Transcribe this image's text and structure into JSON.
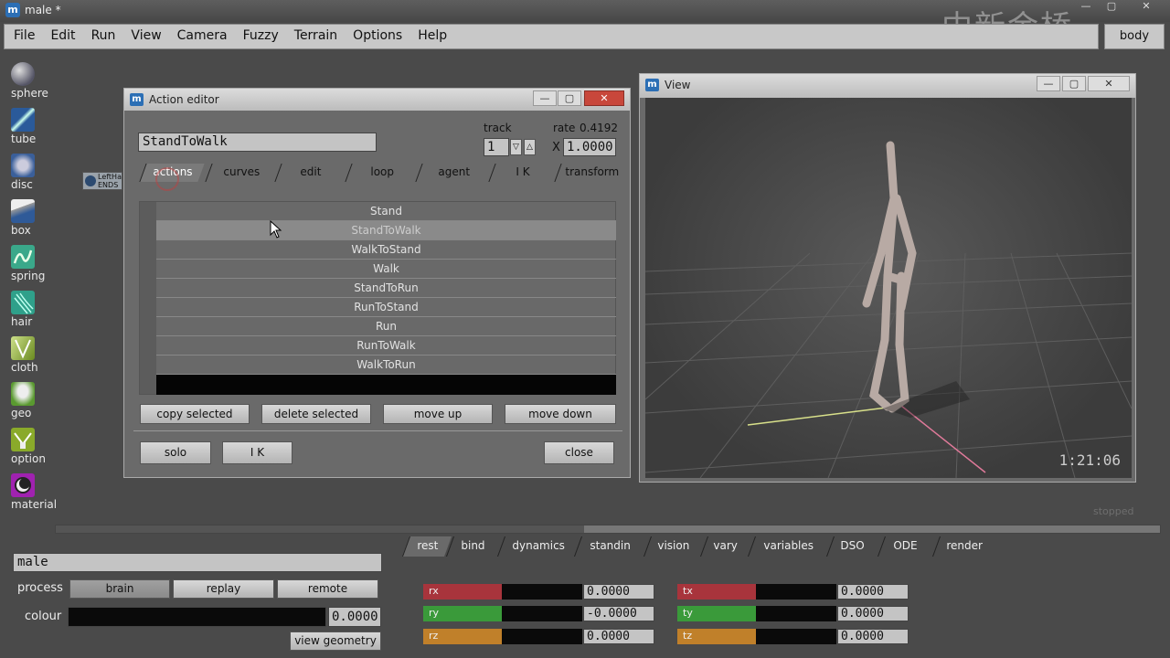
{
  "window": {
    "title": "male *",
    "watermark": "中新金桥",
    "min": "—",
    "max": "▢",
    "close": "✕"
  },
  "menu": {
    "items": [
      "File",
      "Edit",
      "Run",
      "View",
      "Camera",
      "Fuzzy",
      "Terrain",
      "Options",
      "Help"
    ],
    "body_button": "body"
  },
  "tools": [
    {
      "label": "sphere",
      "icon": "sphere-icon",
      "color": "#3a6aa8"
    },
    {
      "label": "tube",
      "icon": "tube-icon",
      "color": "#4a7ac0"
    },
    {
      "label": "disc",
      "icon": "disc-icon",
      "color": "#3f6fb0"
    },
    {
      "label": "box",
      "icon": "box-icon",
      "color": "#2f64a8"
    },
    {
      "label": "spring",
      "icon": "spring-icon",
      "color": "#3aa88a"
    },
    {
      "label": "hair",
      "icon": "hair-icon",
      "color": "#2fa08a"
    },
    {
      "label": "cloth",
      "icon": "cloth-icon",
      "color": "#7aa020"
    },
    {
      "label": "geo",
      "icon": "geo-icon",
      "color": "#5a9a30"
    },
    {
      "label": "option",
      "icon": "option-icon",
      "color": "#8aaa2a"
    },
    {
      "label": "material",
      "icon": "material-icon",
      "color": "#a022b0"
    }
  ],
  "node": {
    "label_line1": "LeftHa",
    "label_line2": "ENDS"
  },
  "action_editor": {
    "title": "Action editor",
    "name": "StandToWalk",
    "track_label": "track",
    "track_value": "1",
    "spin_down": "▽",
    "spin_up": "△",
    "rate_label": "rate",
    "rate_value": "0.4192",
    "x_label": "X",
    "x_value": "1.0000",
    "tabs": [
      "actions",
      "curves",
      "edit",
      "loop",
      "agent",
      "I K",
      "transform"
    ],
    "actions": [
      "Stand",
      "StandToWalk",
      "WalkToStand",
      "Walk",
      "StandToRun",
      "RunToStand",
      "Run",
      "RunToWalk",
      "WalkToRun"
    ],
    "selected_index": 1,
    "buttons": {
      "copy": "copy selected",
      "delete": "delete selected",
      "up": "move up",
      "down": "move down",
      "solo": "solo",
      "ik": "I K",
      "close": "close"
    }
  },
  "view": {
    "title": "View",
    "timecode": "1:21:06",
    "status": "stopped"
  },
  "bottom": {
    "name": "male",
    "process_label": "process",
    "process_buttons": [
      "brain",
      "replay",
      "remote"
    ],
    "colour_label": "colour",
    "colour_value": "0.0000",
    "view_geometry": "view geometry",
    "tabs": [
      "rest",
      "bind",
      "dynamics",
      "standin",
      "vision",
      "vary",
      "variables",
      "DSO",
      "ODE",
      "render"
    ],
    "sliders_left": [
      {
        "label": "rx",
        "value": "0.0000",
        "color": "#a8343c"
      },
      {
        "label": "ry",
        "value": "-0.0000",
        "color": "#3a9a3a"
      },
      {
        "label": "rz",
        "value": "0.0000",
        "color": "#c0802a"
      }
    ],
    "sliders_right": [
      {
        "label": "tx",
        "value": "0.0000",
        "color": "#a8343c"
      },
      {
        "label": "ty",
        "value": "0.0000",
        "color": "#3a9a3a"
      },
      {
        "label": "tz",
        "value": "0.0000",
        "color": "#c0802a"
      }
    ]
  }
}
